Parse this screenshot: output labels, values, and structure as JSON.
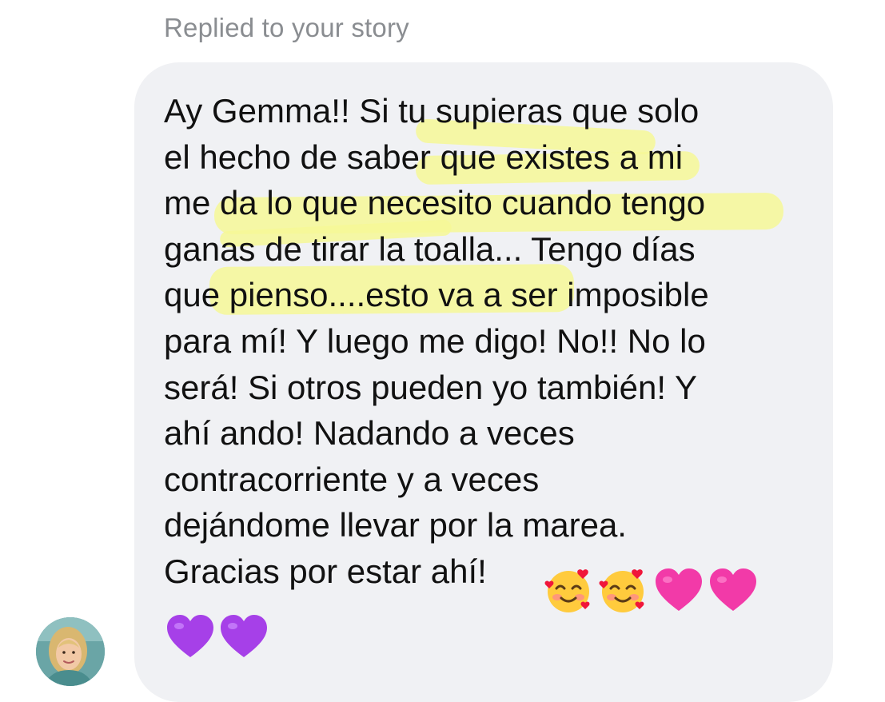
{
  "reply_header": "Replied to your story",
  "message": {
    "lines": [
      "Ay Gemma!! Si tu supieras que solo",
      "el hecho de saber que existes a mi",
      "me da lo que necesito cuando tengo",
      "ganas de tirar la toalla... Tengo días",
      "que pienso....esto va a ser imposible",
      "para mí! Y luego me digo! No!! No lo",
      "será! Si otros pueden yo también! Y",
      "ahí ando! Nadando a veces",
      "contracorriente y a veces",
      "dejándome llevar por la marea.",
      "Gracias por estar ahí!"
    ],
    "emojis": [
      "smiling-face-with-hearts",
      "smiling-face-with-hearts",
      "pink-heart",
      "pink-heart",
      "purple-heart",
      "purple-heart"
    ]
  },
  "colors": {
    "bubble": "#f0f1f4",
    "highlight": "#f6f896",
    "pink_heart": "#f23aa8",
    "purple_heart": "#a640e8",
    "header_text": "#8a8d91"
  }
}
